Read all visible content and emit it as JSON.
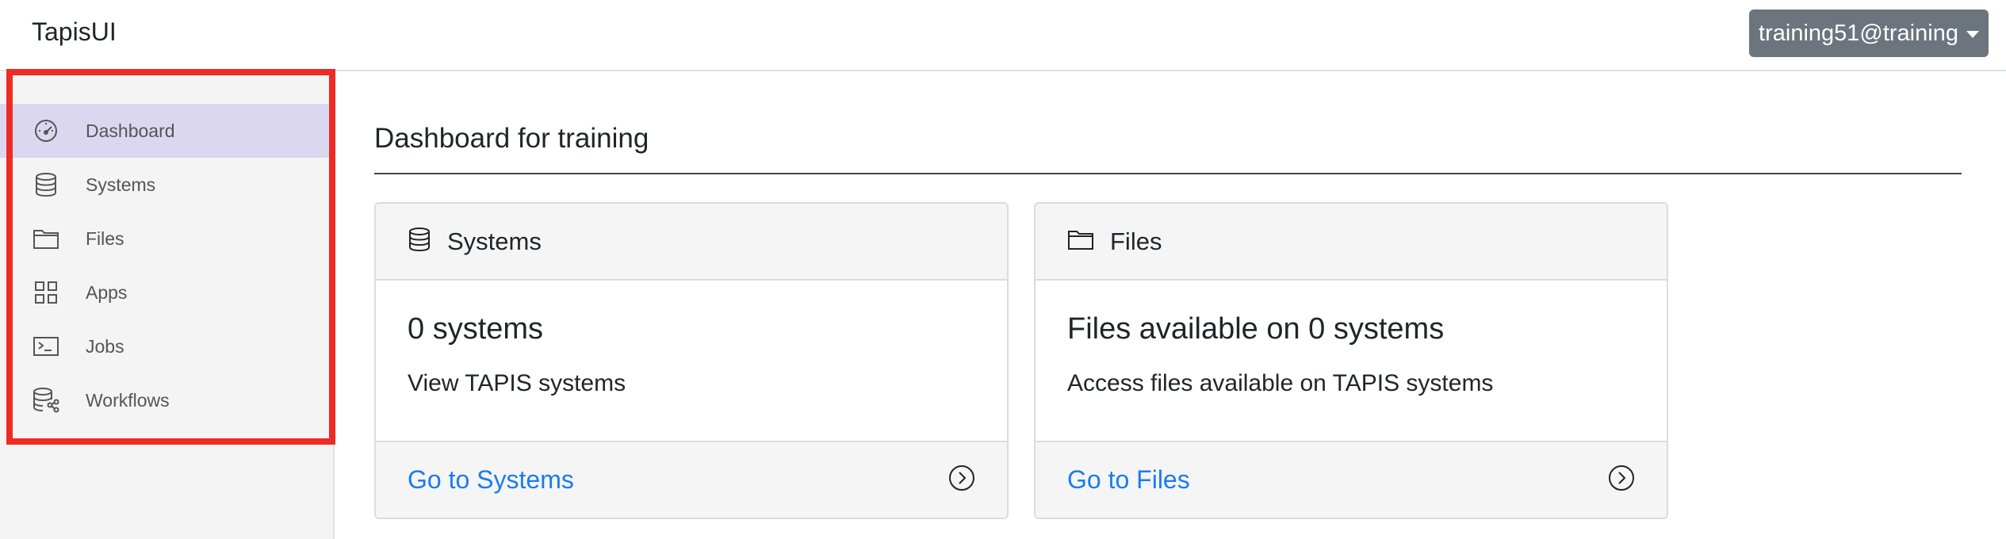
{
  "header": {
    "brand": "TapisUI",
    "user_menu_label": "training51@training"
  },
  "sidebar": {
    "items": [
      {
        "label": "Dashboard",
        "icon": "dashboard-gauge-icon",
        "active": true
      },
      {
        "label": "Systems",
        "icon": "database-icon",
        "active": false
      },
      {
        "label": "Files",
        "icon": "folder-icon",
        "active": false
      },
      {
        "label": "Apps",
        "icon": "grid-icon",
        "active": false
      },
      {
        "label": "Jobs",
        "icon": "terminal-icon",
        "active": false
      },
      {
        "label": "Workflows",
        "icon": "database-network-icon",
        "active": false
      }
    ]
  },
  "main": {
    "title": "Dashboard for training",
    "cards": [
      {
        "header": "Systems",
        "icon": "database-icon",
        "count_text": "0 systems",
        "description": "View TAPIS systems",
        "link": "Go to Systems"
      },
      {
        "header": "Files",
        "icon": "folder-icon",
        "count_text": "Files available on 0 systems",
        "description": "Access files available on TAPIS systems",
        "link": "Go to Files"
      }
    ]
  },
  "colors": {
    "active_sidebar_bg": "#dcd7f0",
    "highlight_border": "#ee2b24",
    "link": "#1a7cf0",
    "user_button_bg": "#6c757d"
  }
}
